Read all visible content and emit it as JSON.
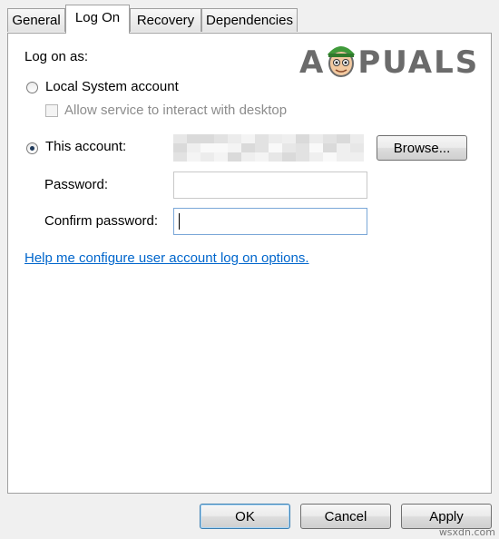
{
  "tabs": [
    {
      "label": "General"
    },
    {
      "label": "Log On"
    },
    {
      "label": "Recovery"
    },
    {
      "label": "Dependencies"
    }
  ],
  "logon": {
    "heading": "Log on as:",
    "local_system_label": "Local System account",
    "allow_desktop_label": "Allow service to interact with desktop",
    "this_account_label": "This account:",
    "browse_label": "Browse...",
    "password_label": "Password:",
    "confirm_password_label": "Confirm password:",
    "help_link": "Help me configure user account log on options.",
    "selected_option": "this_account"
  },
  "footer": {
    "ok_label": "OK",
    "cancel_label": "Cancel",
    "apply_label": "Apply"
  },
  "branding": {
    "logo_a": "A",
    "logo_rest": "PUALS",
    "watermark": "wsxdn.com"
  },
  "colors": {
    "link": "#0066cc",
    "logo_gray": "#6b6b6b",
    "mascot_hat": "#3f9a3a"
  }
}
